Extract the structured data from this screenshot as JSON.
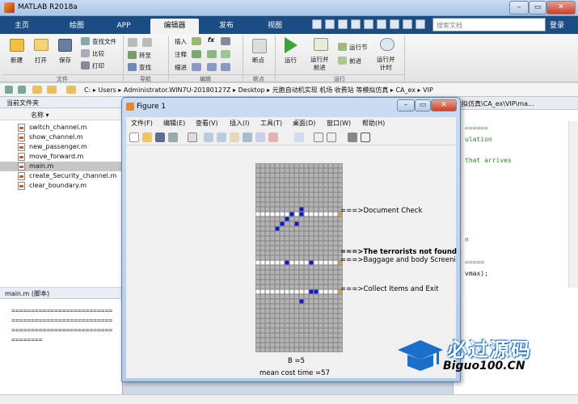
{
  "window": {
    "title": "MATLAB R2018a",
    "min": "–",
    "max": "▭",
    "close": "✕"
  },
  "tabs": [
    {
      "label": "主页"
    },
    {
      "label": "绘图"
    },
    {
      "label": "APP"
    },
    {
      "label": "编辑器"
    },
    {
      "label": "发布"
    },
    {
      "label": "视图"
    }
  ],
  "search": {
    "placeholder": "搜索文档"
  },
  "login": "登录",
  "ribbon": {
    "new": "新建",
    "open": "打开",
    "save": "保存",
    "find_files": "查找文件",
    "compare": "比较",
    "print": "打印",
    "goto": "转至",
    "find": "查找",
    "insert": "插入",
    "comment": "注释",
    "indent": "缩进",
    "breakpoint": "断点",
    "run": "运行",
    "run_advance": "运行并\n前进",
    "run_section": "运行节",
    "advance": "前进",
    "run_time": "运行并\n计时",
    "groups": {
      "file": "文件",
      "nav": "导航",
      "edit": "编辑",
      "breakpoint": "断点",
      "run": "运行"
    },
    "fx": "fx"
  },
  "address": {
    "path": "C: ▸ Users ▸ Administrator.WIN7U-20180127Z ▸ Desktop ▸ 元胞自动机实现 机场 收费站 等模拟仿真 ▸ CA_ex ▸ VIP"
  },
  "file_browser": {
    "header": "当前文件夹",
    "column": "名称 ▾",
    "files": [
      {
        "name": "switch_channel.m"
      },
      {
        "name": "show_channel.m"
      },
      {
        "name": "new_passenger.m"
      },
      {
        "name": "move_forward.m"
      },
      {
        "name": "main.m"
      },
      {
        "name": "create_Security_channel.m"
      },
      {
        "name": "clear_boundary.m"
      }
    ]
  },
  "details": {
    "header": "main.m  (脚本)",
    "lines": [
      "==========================",
      "==========================",
      "==========================",
      "========"
    ]
  },
  "editor": {
    "tab": "模拟仿真\\CA_ex\\VIP\\ma...",
    "lines": [
      {
        "text": "======"
      },
      {
        "text": "ulation"
      },
      {
        "text": "that arrives"
      },
      {
        "text": "n"
      },
      {
        "text": "====="
      },
      {
        "text": "vmax);"
      }
    ]
  },
  "figure": {
    "title": "Figure 1",
    "menu": [
      "文件(F)",
      "编辑(E)",
      "查看(V)",
      "插入(I)",
      "工具(T)",
      "桌面(D)",
      "窗口(W)",
      "帮助(H)"
    ],
    "labels": {
      "doc_check": "===>Document Check",
      "terrorists": "===>The terrorists not found",
      "baggage": "===>Baggage and body Screening",
      "collect": "===>Collect Items and Exit"
    },
    "b_label": "B =5",
    "cost_label": "mean cost time =57"
  },
  "watermark": {
    "brand": "必过源码",
    "url": "Biguo100.CN"
  }
}
